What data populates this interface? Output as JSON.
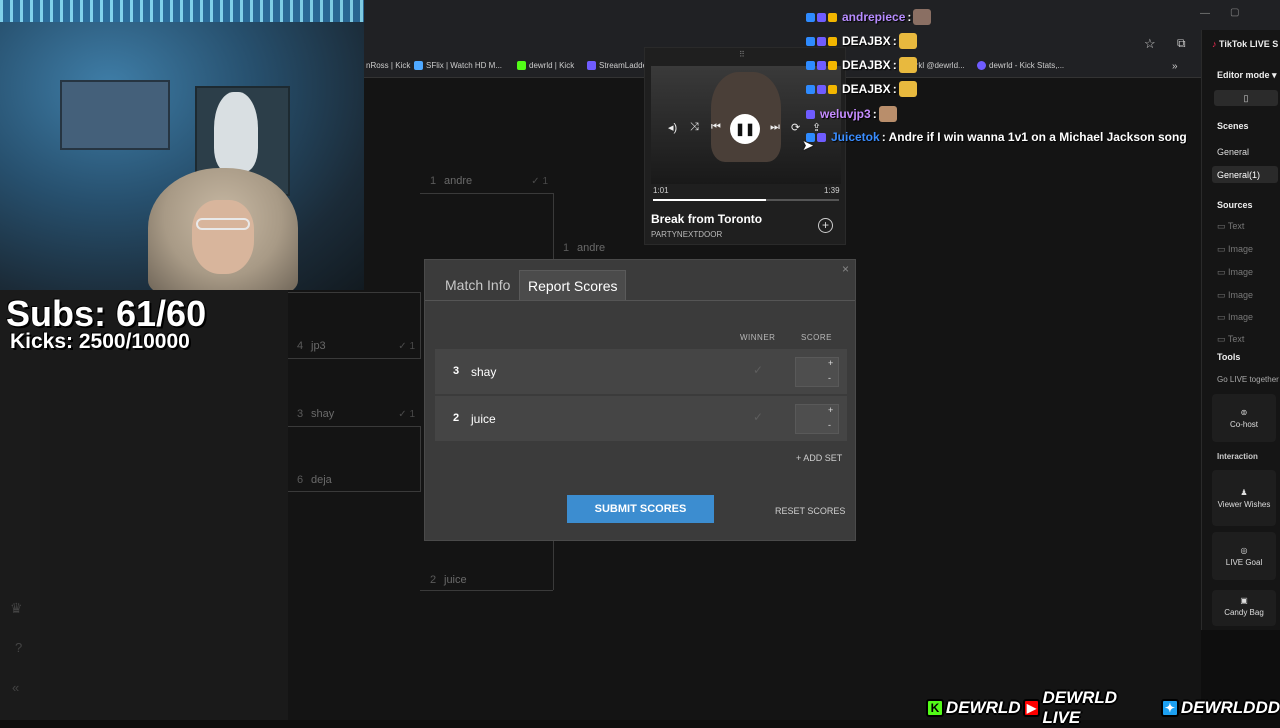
{
  "bookmarks": [
    {
      "label": "nRoss | Kick",
      "color": "#53fc18"
    },
    {
      "label": "SFlix | Watch HD M...",
      "color": "#4ea8ff"
    },
    {
      "label": "dewrld | Kick",
      "color": "#53fc18"
    },
    {
      "label": "StreamLadde...",
      "color": "#6f5cff"
    },
    {
      "label": "...rkl @dewrld...",
      "color": "#888888"
    },
    {
      "label": "dewrld - Kick Stats,...",
      "color": "#6f5cff"
    }
  ],
  "overlay": {
    "subs": "Subs: 61/60",
    "kicks": "Kicks: 2500/10000"
  },
  "bracket": {
    "slots": [
      {
        "seed": "1",
        "name": "andre",
        "check": "✓ 1"
      },
      {
        "seed": "1",
        "name": "andre",
        "check": ""
      },
      {
        "seed": "4",
        "name": "jp3",
        "check": "✓ 1"
      },
      {
        "seed": "3",
        "name": "shay",
        "check": "✓ 1"
      },
      {
        "seed": "6",
        "name": "deja",
        "check": ""
      },
      {
        "seed": "2",
        "name": "juice",
        "check": ""
      }
    ]
  },
  "music": {
    "time_current": "1:01",
    "time_total": "1:39",
    "progress": 0.61,
    "song": "Break from Toronto",
    "artist": "PARTYNEXTDOOR"
  },
  "chat": [
    {
      "user": "andrepiece",
      "text": ":",
      "color": "#b78cff"
    },
    {
      "user": "DEAJBX",
      "text": ":",
      "color": "#ffffff"
    },
    {
      "user": "DEAJBX",
      "text": ":",
      "color": "#ffffff"
    },
    {
      "user": "DEAJBX",
      "text": ":",
      "color": "#ffffff"
    },
    {
      "user": "weluvjp3",
      "text": ":",
      "color": "#c58cff"
    },
    {
      "user": "Juicetok",
      "text": ": Andre if I win wanna 1v1 on a Michael Jackson song",
      "color": "#3a8dff"
    }
  ],
  "modal": {
    "close": "×",
    "tabs": [
      "Match Info",
      "Report Scores"
    ],
    "col_winner": "WINNER",
    "col_score": "SCORE",
    "players": [
      {
        "seed": "3",
        "name": "shay"
      },
      {
        "seed": "2",
        "name": "juice"
      }
    ],
    "plus": "+",
    "minus": "-",
    "add_set": "+ ADD SET",
    "submit": "SUBMIT SCORES",
    "reset": "RESET SCORES"
  },
  "tiktok": {
    "tab": "TikTok LIVE S",
    "editor_mode": "Editor mode",
    "scenes_h": "Scenes",
    "scenes": [
      "General",
      "General(1)"
    ],
    "sources_h": "Sources",
    "sources": [
      "Text",
      "Image",
      "Image",
      "Image",
      "Image",
      "Text"
    ],
    "tools_h": "Tools",
    "go_live": "Go LIVE together",
    "cohost": "Co-host",
    "interaction_h": "Interaction",
    "viewer_wishes": "Viewer Wishes",
    "live_goal": "LIVE Goal",
    "candy": "Candy Bag"
  },
  "banner": {
    "kick": "DEWRLD",
    "youtube": "DEWRLD LIVE",
    "twitter": "DEWRLDDD"
  }
}
